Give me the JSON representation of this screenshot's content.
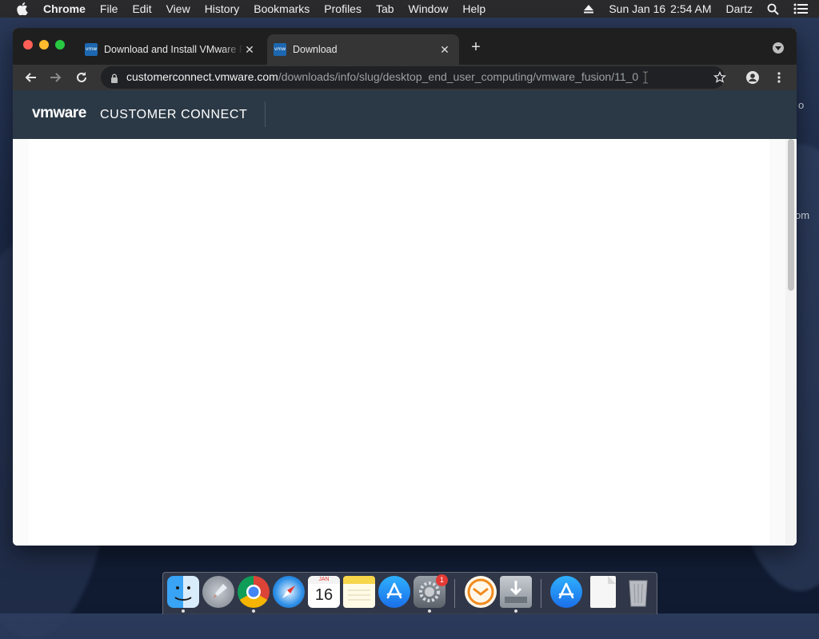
{
  "menubar": {
    "app": "Chrome",
    "items": [
      "File",
      "Edit",
      "View",
      "History",
      "Bookmarks",
      "Profiles",
      "Tab",
      "Window",
      "Help"
    ],
    "date": "Sun Jan 16",
    "time": "2:54 AM",
    "user": "Dartz"
  },
  "browser": {
    "tabs": [
      {
        "title": "Download and Install VMware F",
        "favicon": "vmw"
      },
      {
        "title": "Download",
        "favicon": "vmw"
      }
    ],
    "url_host": "customerconnect.vmware.com",
    "url_path": "/downloads/info/slug/desktop_end_user_computing/vmware_fusion/11_0"
  },
  "site": {
    "logo_brand": "vmware",
    "logo_text": "CUSTOMER CONNECT"
  },
  "desktop_peek": {
    "a": "o",
    "b": "om"
  },
  "dock": {
    "calendar_month": "JAN",
    "calendar_day": "16",
    "system_prefs_badge": "1"
  },
  "colors": {
    "header": "#2b3946",
    "tabstrip": "#1f1f1f",
    "toolbar": "#353535"
  }
}
